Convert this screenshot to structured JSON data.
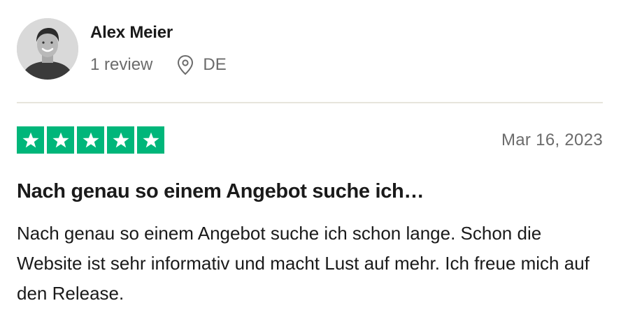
{
  "reviewer": {
    "name": "Alex Meier",
    "review_count": "1 review",
    "country": "DE"
  },
  "review": {
    "rating": 5,
    "max_rating": 5,
    "date": "Mar 16, 2023",
    "title": "Nach genau so einem Angebot suche ich…",
    "body": "Nach genau so einem Angebot suche ich schon lange. Schon die Website ist sehr informativ und macht Lust auf mehr. Ich freue mich auf den Release."
  },
  "icons": {
    "avatar": "avatar-photo",
    "location": "location-pin-icon",
    "star": "star-icon"
  },
  "colors": {
    "star_green": "#00b67a",
    "muted_text": "#6b6b6b",
    "divider": "#e7e5dc"
  }
}
